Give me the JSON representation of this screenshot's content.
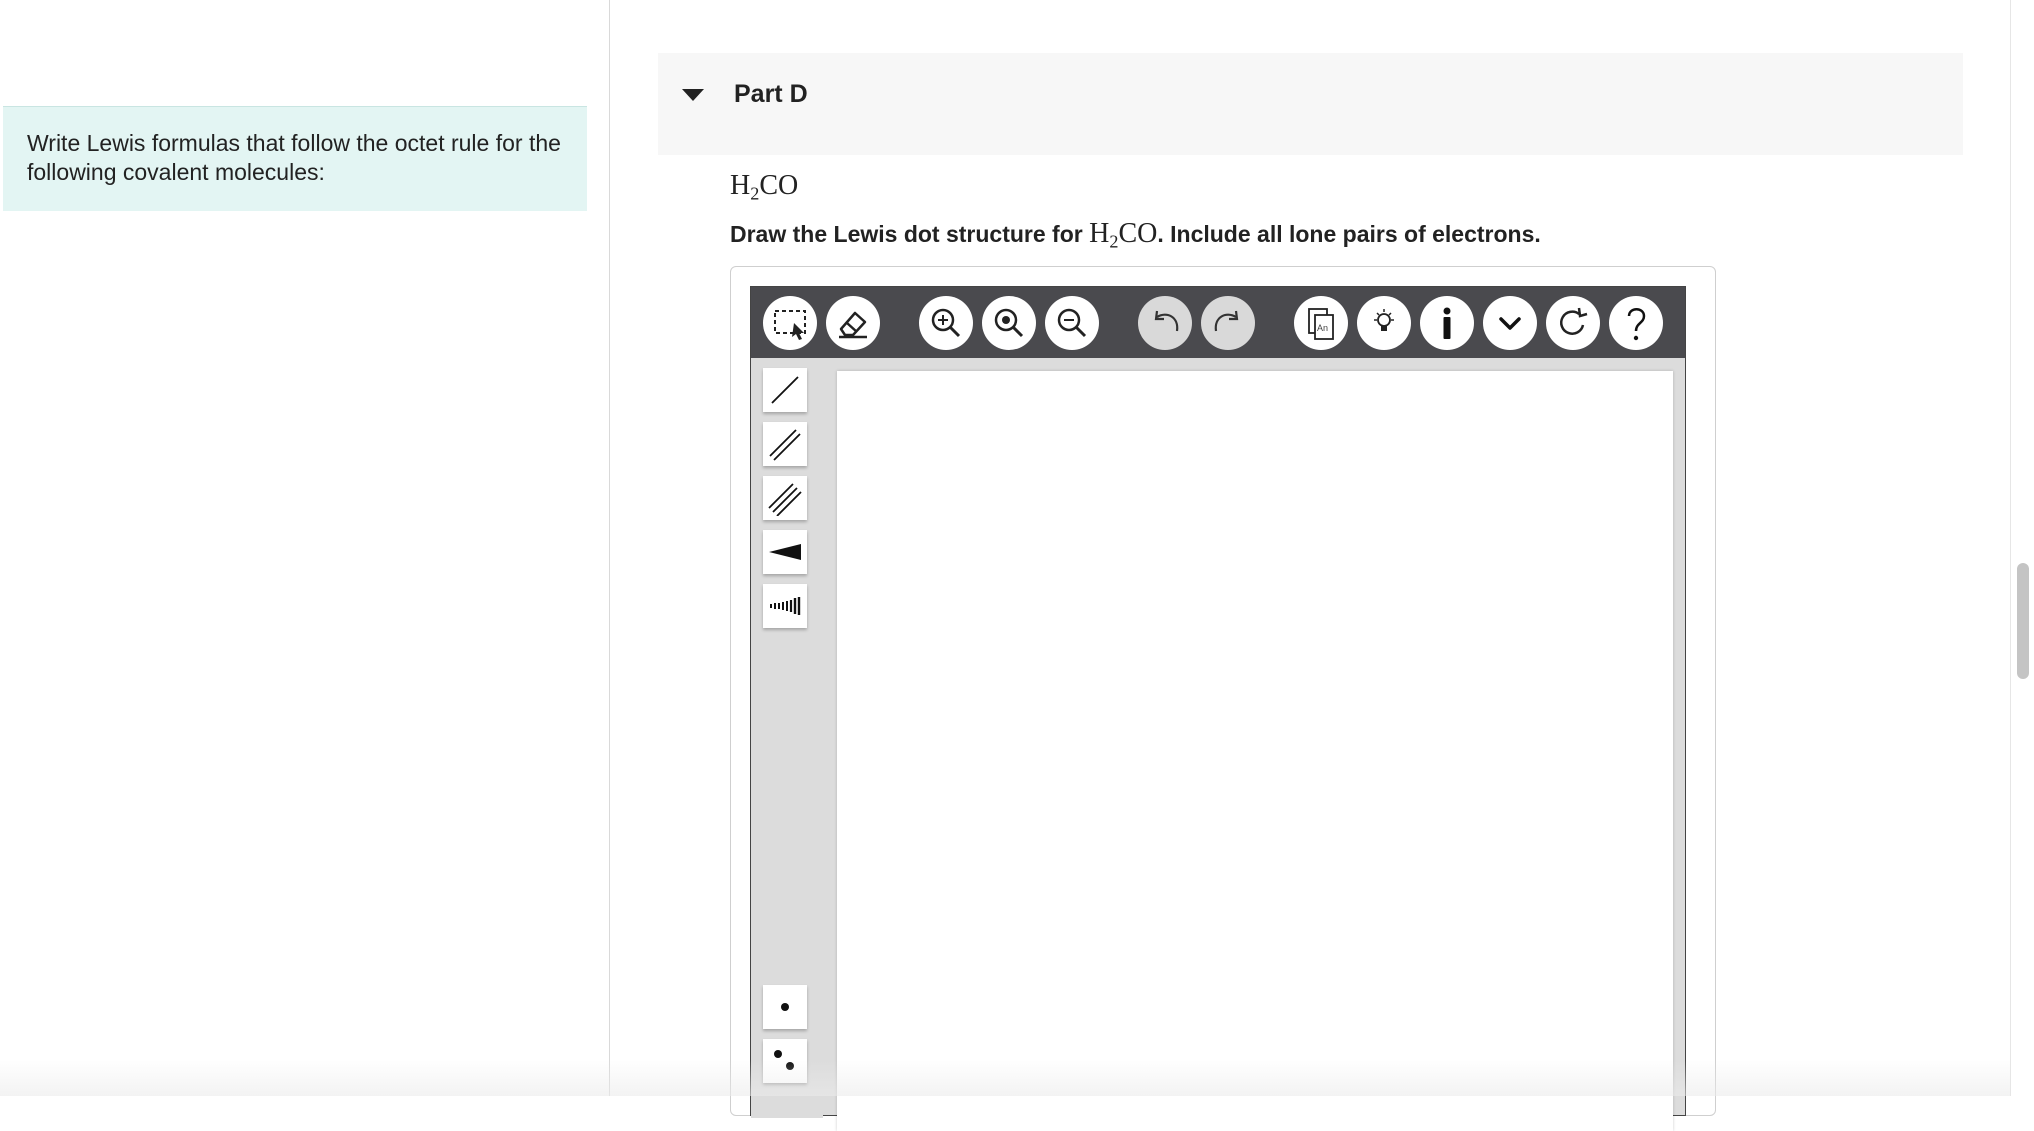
{
  "left_panel": {
    "intro_text": "Write Lewis formulas that follow the octet rule for the following covalent molecules:"
  },
  "part": {
    "title": "Part D",
    "formula": {
      "h": "H",
      "sub": "2",
      "rest": "CO"
    },
    "instruction_prefix": "Draw the Lewis dot structure for ",
    "instruction_suffix": ". Include all lone pairs of electrons."
  },
  "toolbar": {
    "buttons": [
      {
        "icon": "marquee-select-icon",
        "state": "enabled"
      },
      {
        "icon": "eraser-icon",
        "state": "enabled"
      },
      {
        "icon": "zoom-in-icon",
        "state": "enabled"
      },
      {
        "icon": "zoom-reset-icon",
        "state": "enabled"
      },
      {
        "icon": "zoom-out-icon",
        "state": "enabled"
      },
      {
        "icon": "undo-icon",
        "state": "disabled"
      },
      {
        "icon": "redo-icon",
        "state": "disabled"
      },
      {
        "icon": "template-icon",
        "state": "enabled",
        "label": "An"
      },
      {
        "icon": "hint-bulb-icon",
        "state": "enabled"
      },
      {
        "icon": "info-icon",
        "state": "enabled"
      },
      {
        "icon": "chevron-down-icon",
        "state": "enabled"
      },
      {
        "icon": "reset-icon",
        "state": "enabled"
      },
      {
        "icon": "help-icon",
        "state": "enabled"
      }
    ]
  },
  "side_tools": [
    "single-bond-icon",
    "double-bond-icon",
    "triple-bond-icon",
    "wedge-bond-icon",
    "hash-bond-icon",
    "lone-electron-icon",
    "electron-pair-icon"
  ],
  "colors": {
    "toolbar_bg": "#4a4a4e",
    "intro_bg": "#e3f5f3",
    "part_header_bg": "#f7f7f7",
    "disabled_btn": "#d9d9d9"
  }
}
